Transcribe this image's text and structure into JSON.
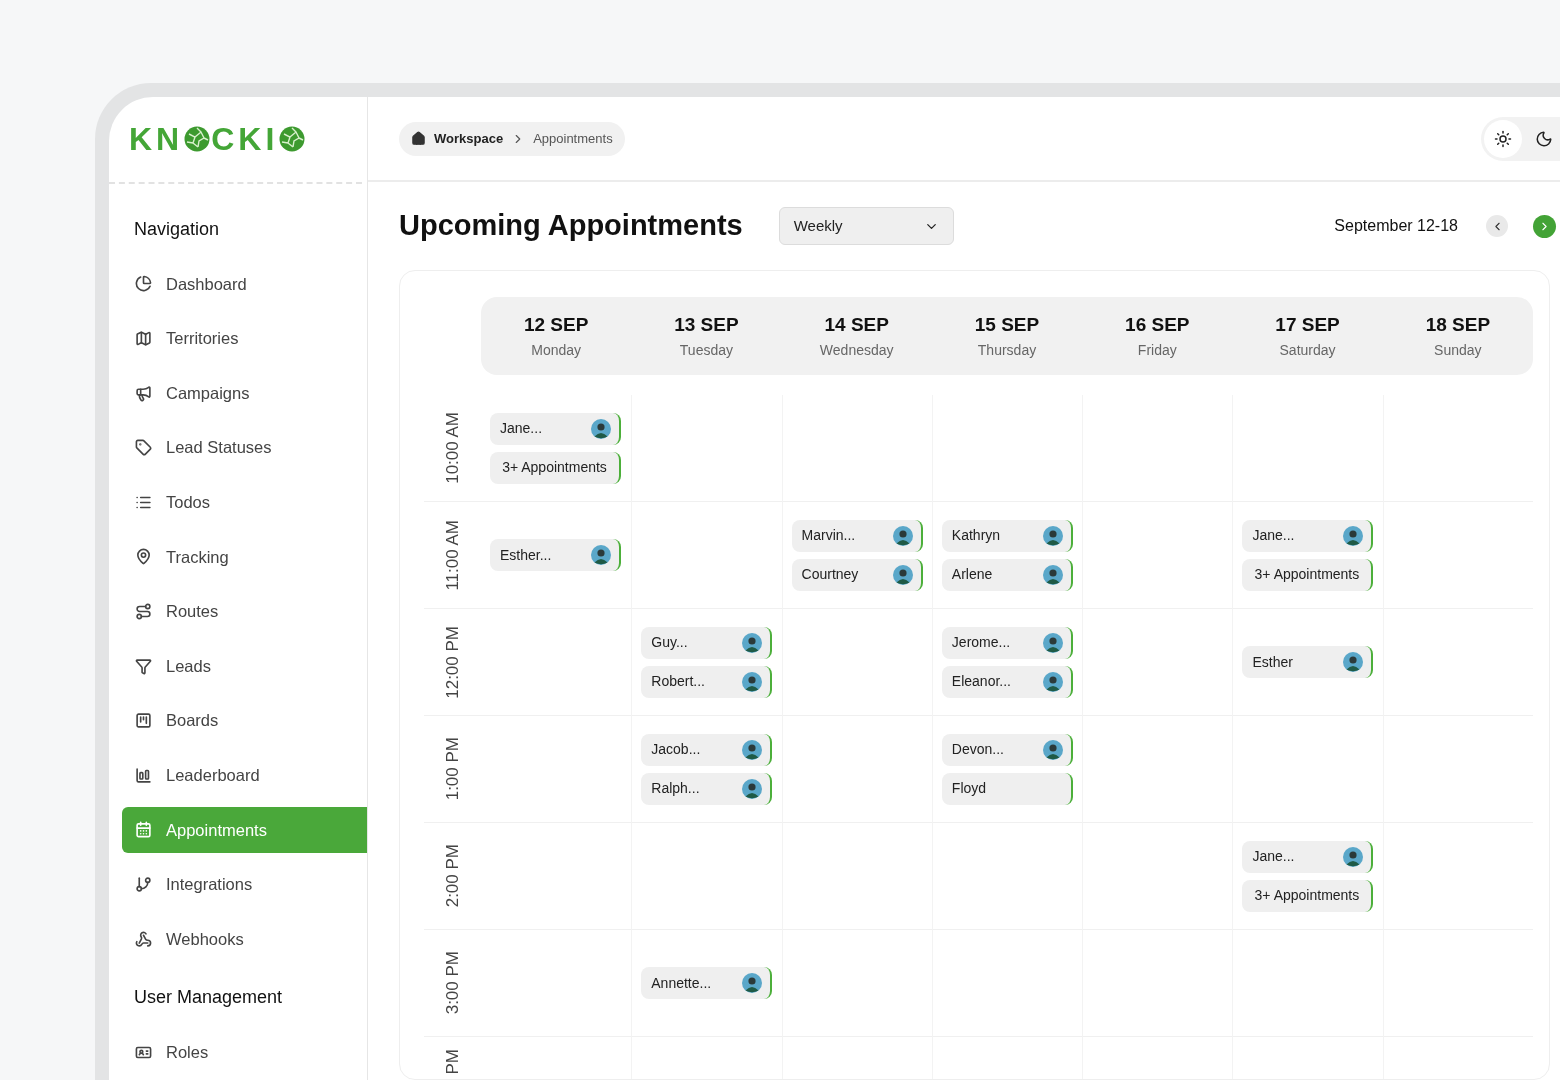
{
  "logo": {
    "part_1": "KN",
    "part_2": "CKI"
  },
  "sidebar": {
    "sections": [
      {
        "title": "Navigation",
        "items": [
          {
            "label": "Dashboard",
            "selected": false
          },
          {
            "label": "Territories",
            "selected": false
          },
          {
            "label": "Campaigns",
            "selected": false
          },
          {
            "label": "Lead Statuses",
            "selected": false
          },
          {
            "label": "Todos",
            "selected": false
          },
          {
            "label": "Tracking",
            "selected": false
          },
          {
            "label": "Routes",
            "selected": false
          },
          {
            "label": "Leads",
            "selected": false
          },
          {
            "label": "Boards",
            "selected": false
          },
          {
            "label": "Leaderboard",
            "selected": false
          },
          {
            "label": "Appointments",
            "selected": true
          },
          {
            "label": "Integrations",
            "selected": false
          },
          {
            "label": "Webhooks",
            "selected": false
          }
        ]
      },
      {
        "title": "User Management",
        "items": [
          {
            "label": "Roles",
            "selected": false
          }
        ]
      }
    ]
  },
  "breadcrumb": [
    "Workspace",
    "Appointments"
  ],
  "theme_toggle": {
    "light_selected": true
  },
  "title": "Upcoming Appointments",
  "view_select": {
    "value": "Weekly"
  },
  "date_range": "September 12-18",
  "days": [
    {
      "date": "12 SEP",
      "weekday": "Monday"
    },
    {
      "date": "13 SEP",
      "weekday": "Tuesday"
    },
    {
      "date": "14 SEP",
      "weekday": "Wednesday"
    },
    {
      "date": "15 SEP",
      "weekday": "Thursday"
    },
    {
      "date": "16 SEP",
      "weekday": "Friday"
    },
    {
      "date": "17 SEP",
      "weekday": "Saturday"
    },
    {
      "date": "18 SEP",
      "weekday": "Sunday"
    }
  ],
  "rows": [
    {
      "time": "10:00 AM",
      "cells": [
        [
          {
            "kind": "person",
            "name": "Jane..."
          },
          {
            "kind": "more",
            "name": "3+ Appointments"
          }
        ],
        [],
        [],
        [],
        [],
        [],
        []
      ]
    },
    {
      "time": "11:00 AM",
      "cells": [
        [
          {
            "kind": "person",
            "name": "Esther..."
          }
        ],
        [],
        [
          {
            "kind": "person",
            "name": "Marvin..."
          },
          {
            "kind": "person",
            "name": "Courtney"
          }
        ],
        [
          {
            "kind": "person",
            "name": "Kathryn"
          },
          {
            "kind": "person",
            "name": "Arlene"
          }
        ],
        [],
        [
          {
            "kind": "person",
            "name": "Jane..."
          },
          {
            "kind": "more",
            "name": "3+ Appointments"
          }
        ],
        []
      ]
    },
    {
      "time": "12:00 PM",
      "cells": [
        [],
        [
          {
            "kind": "person",
            "name": "Guy..."
          },
          {
            "kind": "person",
            "name": "Robert..."
          }
        ],
        [],
        [
          {
            "kind": "person",
            "name": "Jerome..."
          },
          {
            "kind": "person",
            "name": "Eleanor..."
          }
        ],
        [],
        [
          {
            "kind": "person",
            "name": "Esther"
          }
        ],
        []
      ]
    },
    {
      "time": "1:00 PM",
      "cells": [
        [],
        [
          {
            "kind": "person",
            "name": "Jacob..."
          },
          {
            "kind": "person",
            "name": "Ralph..."
          }
        ],
        [],
        [
          {
            "kind": "person",
            "name": "Devon..."
          },
          {
            "kind": "plain",
            "name": "Floyd"
          }
        ],
        [],
        [],
        []
      ]
    },
    {
      "time": "2:00 PM",
      "cells": [
        [],
        [],
        [],
        [],
        [],
        [
          {
            "kind": "person",
            "name": "Jane..."
          },
          {
            "kind": "more",
            "name": "3+ Appointments"
          }
        ],
        []
      ]
    },
    {
      "time": "3:00 PM",
      "cells": [
        [],
        [
          {
            "kind": "person",
            "name": "Annette..."
          }
        ],
        [],
        [],
        [],
        [],
        []
      ]
    },
    {
      "time": "PM",
      "cells": [
        [],
        [],
        [],
        [],
        [],
        [],
        []
      ]
    }
  ]
}
